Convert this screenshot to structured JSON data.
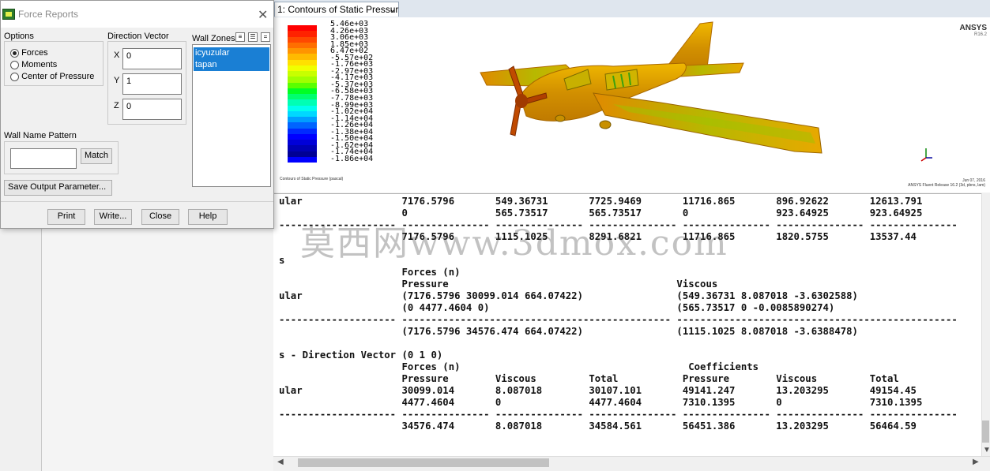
{
  "graphics": {
    "tab_label": "1: Contours of Static Pressur",
    "brand": "ANSYS",
    "brand_version": "R16.2",
    "caption": "Contours of Static Pressure (pascal)",
    "footer": "Jun 07, 2016\nANSYS Fluent Release 16.2 (3d, pbns, lam)",
    "legend_labels": [
      "5.46e+03",
      "4.26e+03",
      "3.06e+03",
      "1.85e+03",
      "6.47e+02",
      "-5.57e+02",
      "-1.76e+03",
      "-2.97e+03",
      "-4.17e+03",
      "-5.37e+03",
      "-6.58e+03",
      "-7.78e+03",
      "-8.99e+03",
      "-1.02e+04",
      "-1.14e+04",
      "-1.26e+04",
      "-1.38e+04",
      "-1.50e+04",
      "-1.62e+04",
      "-1.74e+04",
      "-1.86e+04"
    ],
    "legend_colors": [
      "#ff0000",
      "#ff2200",
      "#ff4800",
      "#ff6e00",
      "#ff9400",
      "#ffba00",
      "#ffe000",
      "#f0ff00",
      "#c8ff00",
      "#a0ff00",
      "#5aff00",
      "#00ff24",
      "#00ff6e",
      "#00ffb4",
      "#00ffee",
      "#00d8ff",
      "#009eff",
      "#0064ff",
      "#002aff",
      "#0000ff",
      "#0000d8",
      "#0000b4",
      "#000094",
      "#0000ff"
    ]
  },
  "console": {
    "lines": [
      "ular                 7176.5796       549.36731       7725.9469       11716.865       896.92622       12613.791",
      "                     0               565.73517       565.73517       0               923.64925       923.64925",
      "-------------------- --------------- --------------- --------------- --------------- --------------- ---------------",
      "                     7176.5796       1115.1025       8291.6821       11716.865       1820.5755       13537.44",
      "",
      "s",
      "                     Forces (n)",
      "                     Pressure                                       Viscous",
      "ular                 (7176.5796 30099.014 664.07422)                (549.36731 8.087018 -3.6302588)",
      "                     (0 4477.4604 0)                                (565.73517 0 -0.0085890274)",
      "-------------------- ---------------------------------------------- ------------------------------------------------",
      "                     (7176.5796 34576.474 664.07422)                (1115.1025 8.087018 -3.6388478)",
      "",
      "s - Direction Vector (0 1 0)",
      "                     Forces (n)                                       Coefficients",
      "                     Pressure        Viscous         Total           Pressure        Viscous         Total",
      "ular                 30099.014       8.087018        30107.101       49141.247       13.203295       49154.45",
      "                     4477.4604       0               4477.4604       7310.1395       0               7310.1395",
      "-------------------- --------------- --------------- --------------- --------------- --------------- ---------------",
      "                     34576.474       8.087018        34584.561       56451.386       13.203295       56464.59"
    ],
    "watermark": "莫西网www.3dmox.com"
  },
  "dialog": {
    "title": "Force Reports",
    "options_label": "Options",
    "options": [
      {
        "label": "Forces",
        "selected": true
      },
      {
        "label": "Moments",
        "selected": false
      },
      {
        "label": "Center of Pressure",
        "selected": false
      }
    ],
    "direction_label": "Direction Vector",
    "direction": [
      {
        "axis": "X",
        "value": "0"
      },
      {
        "axis": "Y",
        "value": "1"
      },
      {
        "axis": "Z",
        "value": "0"
      }
    ],
    "wall_zones_label": "Wall Zones",
    "wall_zones": [
      "icyuzular",
      "tapan"
    ],
    "pattern_label": "Wall Name Pattern",
    "pattern_value": "",
    "match_label": "Match",
    "save_param_label": "Save Output Parameter...",
    "buttons": {
      "print": "Print",
      "write": "Write...",
      "close": "Close",
      "help": "Help"
    }
  }
}
